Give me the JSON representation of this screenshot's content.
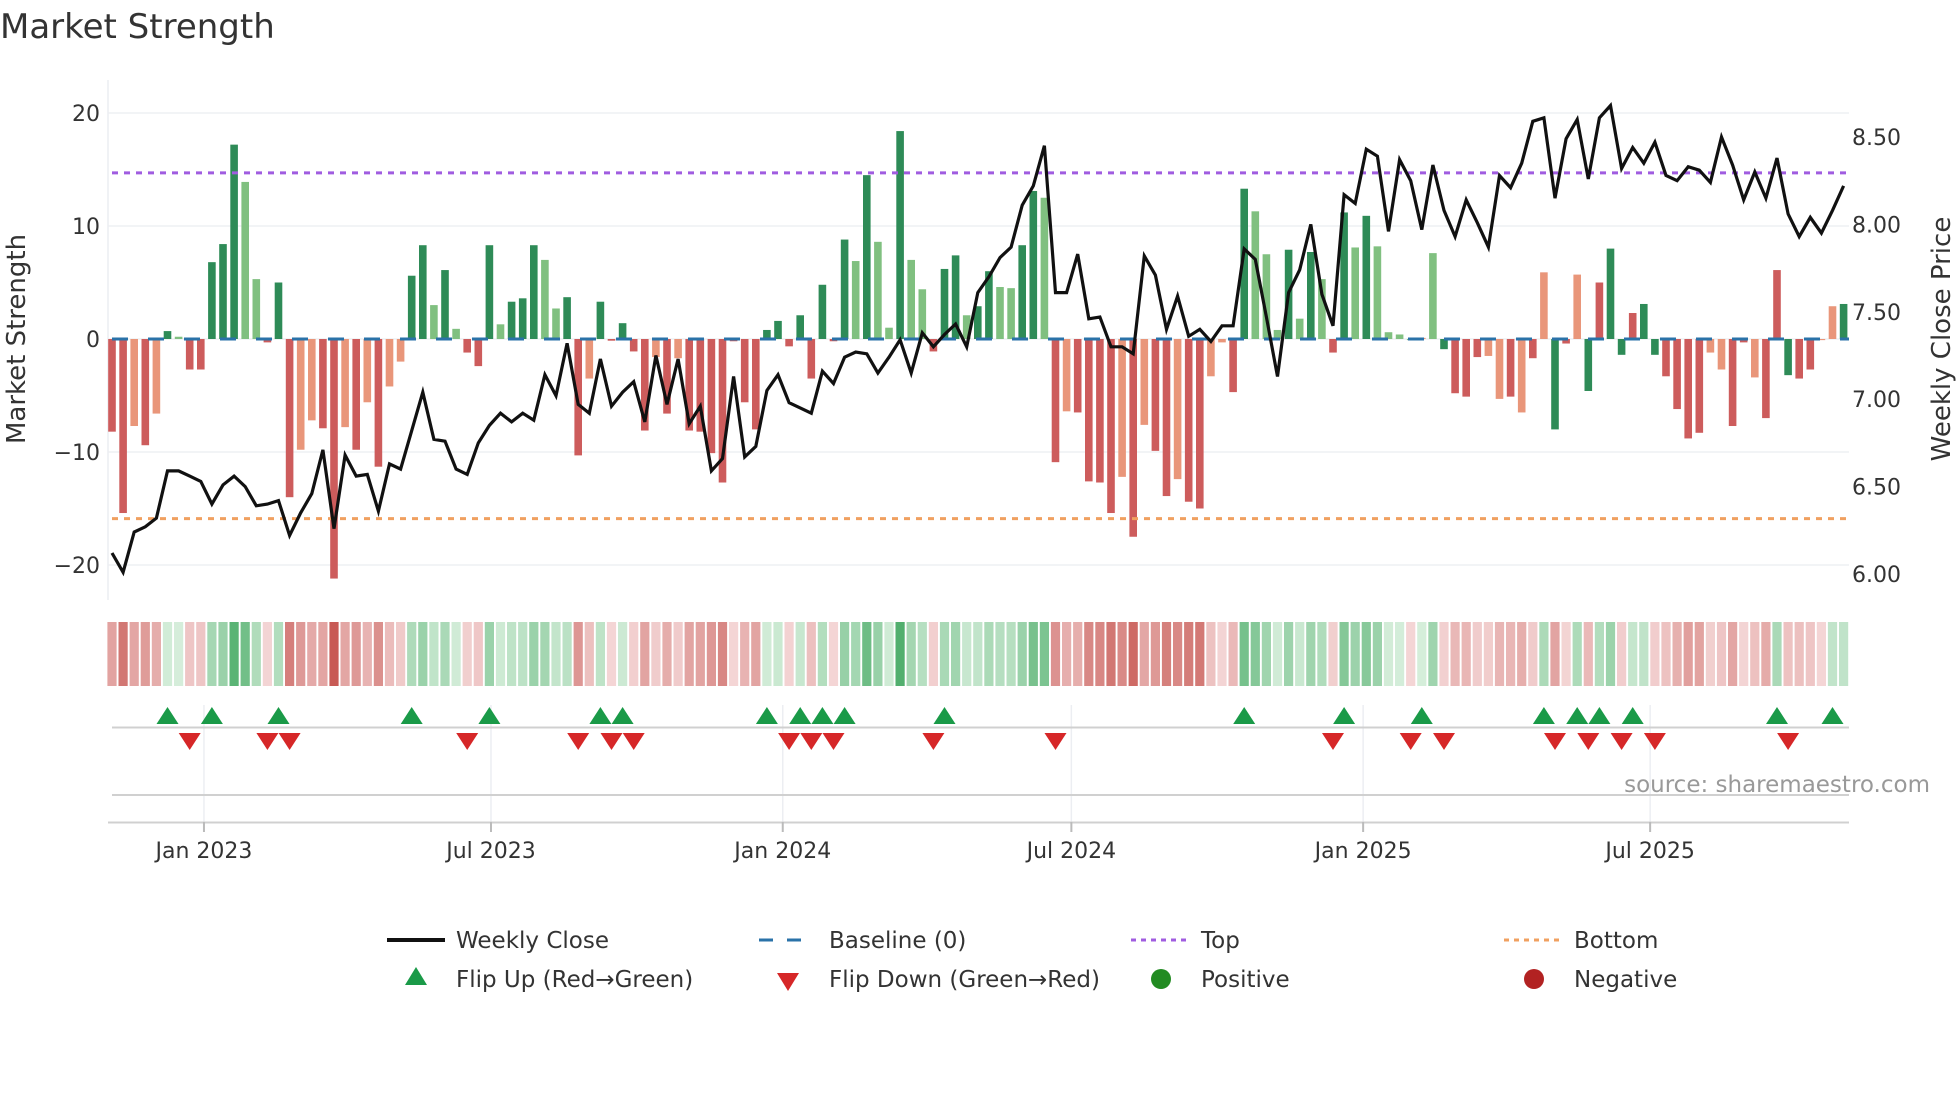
{
  "chart_data": {
    "type": "bar",
    "title": "Market Strength",
    "ylabel": "Market Strength",
    "y2label": "Weekly Close Price",
    "ylim": [
      -23,
      23
    ],
    "y2lim": [
      5.9,
      8.75
    ],
    "yticks": [
      20,
      10,
      0,
      -10,
      -20
    ],
    "ytick_labels": [
      "20",
      "10",
      "0",
      "−10",
      "−20"
    ],
    "y2ticks": [
      8.5,
      8.0,
      7.5,
      7.0,
      6.5,
      6.0
    ],
    "y2tick_labels": [
      "8.50",
      "8.00",
      "7.50",
      "7.00",
      "6.50",
      "6.00"
    ],
    "x_start_date": "2022-11-04",
    "x_interval": "weekly",
    "xticks": [
      {
        "date": "2023-01-01",
        "label": "Jan 2023"
      },
      {
        "date": "2023-07-01",
        "label": "Jul 2023"
      },
      {
        "date": "2024-01-01",
        "label": "Jan 2024"
      },
      {
        "date": "2024-07-01",
        "label": "Jul 2024"
      },
      {
        "date": "2025-01-01",
        "label": "Jan 2025"
      },
      {
        "date": "2025-07-01",
        "label": "Jul 2025"
      }
    ],
    "top_level": 14.7,
    "bottom_level": -15.9,
    "baseline": 0,
    "strength": [
      -8.2,
      -15.4,
      -7.7,
      -9.4,
      -6.6,
      0.7,
      0.2,
      -2.7,
      -2.7,
      6.8,
      8.4,
      17.2,
      13.9,
      5.3,
      -0.3,
      5.0,
      -14.0,
      -9.8,
      -7.2,
      -7.9,
      -21.2,
      -7.8,
      -9.8,
      -5.6,
      -11.3,
      -4.2,
      -2.0,
      5.6,
      8.3,
      3.0,
      6.1,
      0.9,
      -1.2,
      -2.4,
      8.3,
      1.3,
      3.3,
      3.6,
      8.3,
      7.0,
      2.7,
      3.7,
      -10.3,
      -3.5,
      3.3,
      -0.15,
      1.4,
      -1.1,
      -8.1,
      -1.6,
      -6.6,
      -1.7,
      -8.1,
      -8.2,
      -10.1,
      -12.7,
      -0.2,
      -5.6,
      -8.0,
      0.8,
      1.6,
      -0.65,
      2.1,
      -3.5,
      4.8,
      -0.2,
      8.8,
      6.9,
      14.5,
      8.6,
      1.0,
      18.4,
      7.0,
      4.4,
      -1.1,
      6.2,
      7.4,
      2.1,
      2.9,
      6.0,
      4.6,
      4.5,
      8.3,
      13.1,
      12.5,
      -10.9,
      -6.4,
      -6.5,
      -12.6,
      -12.7,
      -15.4,
      -12.2,
      -17.5,
      -7.6,
      -9.9,
      -13.9,
      -12.4,
      -14.4,
      -15.0,
      -3.3,
      -0.3,
      -4.7,
      13.3,
      11.3,
      7.5,
      0.8,
      7.9,
      1.8,
      7.7,
      5.3,
      -1.2,
      11.2,
      8.1,
      10.9,
      8.2,
      0.6,
      0.4,
      -0.1,
      0.1,
      7.6,
      -0.9,
      -4.8,
      -5.1,
      -1.6,
      -1.5,
      -5.3,
      -5.1,
      -6.5,
      -1.7,
      5.9,
      -8.0,
      -0.4,
      5.7,
      -4.6,
      5.0,
      8.0,
      -1.4,
      2.3,
      3.1,
      -1.4,
      -3.3,
      -6.2,
      -8.8,
      -8.3,
      -1.2,
      -2.7,
      -7.7,
      -0.3,
      -3.4,
      -7.0,
      6.1,
      -3.2,
      -3.5,
      -2.7,
      -0.1,
      2.9,
      3.1
    ],
    "bar_shade": "RRrRrGgRRGGGggRGRrrRRrRrRrrGGgGgRRGgGGGggGRrGRGRRrRrRRRRRRRGGRGRGRGgGgaGggRGGgGGggGGgRrRRRRrRrRRrRRrrRGggaGgGgRGgGggggrgGRRRrrRrRrGRrGRGGRGGRRRRrrRRrRRGRRrrGG",
    "weekly_close": [
      6.12,
      6.01,
      6.24,
      6.27,
      6.32,
      6.59,
      6.59,
      6.56,
      6.53,
      6.4,
      6.51,
      6.56,
      6.5,
      6.39,
      6.4,
      6.42,
      6.22,
      6.35,
      6.46,
      6.71,
      6.26,
      6.68,
      6.56,
      6.57,
      6.36,
      6.63,
      6.6,
      6.82,
      7.04,
      6.77,
      6.76,
      6.6,
      6.57,
      6.75,
      6.85,
      6.92,
      6.87,
      6.92,
      6.88,
      7.14,
      7.02,
      7.32,
      6.97,
      6.92,
      7.23,
      6.96,
      7.04,
      7.1,
      6.87,
      7.25,
      6.97,
      7.23,
      6.86,
      6.96,
      6.59,
      6.66,
      7.13,
      6.67,
      6.73,
      7.05,
      7.14,
      6.98,
      6.95,
      6.92,
      7.16,
      7.09,
      7.24,
      7.27,
      7.26,
      7.15,
      7.24,
      7.34,
      7.15,
      7.38,
      7.3,
      7.37,
      7.43,
      7.3,
      7.61,
      7.7,
      7.81,
      7.87,
      8.11,
      8.22,
      8.45,
      7.61,
      7.61,
      7.83,
      7.46,
      7.47,
      7.3,
      7.3,
      7.26,
      7.82,
      7.71,
      7.4,
      7.59,
      7.36,
      7.4,
      7.33,
      7.42,
      7.42,
      7.86,
      7.8,
      7.47,
      7.13,
      7.61,
      7.74,
      8.0,
      7.6,
      7.42,
      8.17,
      8.12,
      8.43,
      8.39,
      7.96,
      8.37,
      8.25,
      7.97,
      8.34,
      8.08,
      7.93,
      8.14,
      8.01,
      7.87,
      8.28,
      8.21,
      8.35,
      8.59,
      8.61,
      8.15,
      8.49,
      8.6,
      8.26,
      8.61,
      8.68,
      8.32,
      8.44,
      8.35,
      8.47,
      8.28,
      8.25,
      8.33,
      8.31,
      8.24,
      8.5,
      8.34,
      8.14,
      8.3,
      8.15,
      8.38,
      8.06,
      7.93,
      8.04,
      7.95,
      8.08,
      8.22
    ],
    "legend": {
      "placement": "bottom",
      "weekly_close": "Weekly Close",
      "baseline": "Baseline (0)",
      "top": "Top",
      "bottom": "Bottom",
      "flip_up": "Flip Up (Red→Green)",
      "flip_down": "Flip Down (Green→Red)",
      "positive": "Positive",
      "negative": "Negative"
    },
    "annotation": "source: sharemaestro.com",
    "grid": true
  },
  "colors": {
    "bar_dark_green": "#2e8b57",
    "bar_light_green": "#80c080",
    "bar_red": "#cd5c5c",
    "bar_salmon": "#e9967a",
    "line": "#111111",
    "baseline": "#2a72a8",
    "top": "#a05ce0",
    "bottom": "#f0a060",
    "flip_up": "#1a9a48",
    "flip_down": "#d62728",
    "positive": "#228b22",
    "negative": "#b22222"
  }
}
